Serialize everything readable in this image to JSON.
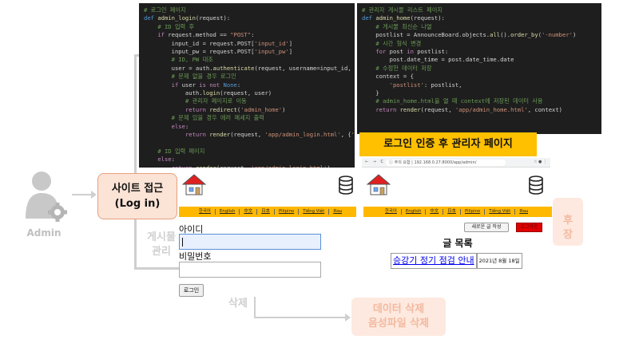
{
  "admin": {
    "label": "Admin"
  },
  "site_access": {
    "line1": "사이트 접근",
    "line2": "(Log in)"
  },
  "faded": {
    "board_manage": "게시물\n관리",
    "delete": "삭제",
    "data_delete": "데이터 삭제\n음성파일 삭제",
    "right_partial": "후\n장"
  },
  "code_left": [
    [
      [
        "cm",
        "# 로그인 페이지"
      ]
    ],
    [
      [
        "df",
        "def "
      ],
      [
        "fn",
        "admin_login"
      ],
      [
        "",
        "(request):"
      ]
    ],
    [
      [
        "",
        "    "
      ],
      [
        "cm",
        "# ID 입력 후"
      ]
    ],
    [
      [
        "",
        "    "
      ],
      [
        "kw",
        "if "
      ],
      [
        "",
        "request.method == "
      ],
      [
        "st",
        "\"POST\""
      ],
      [
        ":"
      ]
    ],
    [
      [
        "",
        "        input_id = request.POST["
      ],
      [
        "st",
        "'input_id'"
      ],
      [
        "",
        "]"
      ]
    ],
    [
      [
        "",
        "        input_pw = request.POST["
      ],
      [
        "st",
        "'input_pw'"
      ],
      [
        "",
        "]"
      ]
    ],
    [
      [
        "",
        "        "
      ],
      [
        "cm",
        "# ID, PW 대조"
      ]
    ],
    [
      [
        "",
        "        user = auth."
      ],
      [
        "fn",
        "authenticate"
      ],
      [
        "",
        "(request, username=input_id, passwo"
      ]
    ],
    [
      [
        "",
        "        "
      ],
      [
        "cm",
        "# 문제 없을 경우 로그인"
      ]
    ],
    [
      [
        "",
        "        "
      ],
      [
        "kw",
        "if "
      ],
      [
        "",
        "user "
      ],
      [
        "kw",
        "is not "
      ],
      [
        "df",
        "None"
      ],
      [
        ":"
      ]
    ],
    [
      [
        "",
        "            auth."
      ],
      [
        "fn",
        "login"
      ],
      [
        "",
        "(request, user)"
      ]
    ],
    [
      [
        "",
        "            "
      ],
      [
        "cm",
        "# 관리자 페이지로 이동"
      ]
    ],
    [
      [
        "",
        "            "
      ],
      [
        "kw",
        "return "
      ],
      [
        "fn",
        "redirect"
      ],
      [
        "",
        "("
      ],
      [
        "st",
        "'admin_home'"
      ],
      [
        ")"
      ]
    ],
    [
      [
        "",
        "        "
      ],
      [
        "cm",
        "# 문제 있을 경우 에러 메세지 출력"
      ]
    ],
    [
      [
        "",
        "        "
      ],
      [
        "kw",
        "else"
      ],
      [
        ":"
      ]
    ],
    [
      [
        "",
        "            "
      ],
      [
        "kw",
        "return "
      ],
      [
        "fn",
        "render"
      ],
      [
        "",
        "(request, "
      ],
      [
        "st",
        "'app/admin_login.html'"
      ],
      [
        "",
        ", {"
      ],
      [
        "st",
        "'error'"
      ]
    ],
    [
      [
        "",
        ""
      ]
    ],
    [
      [
        "",
        "    "
      ],
      [
        "cm",
        "# ID 입력 페이지"
      ]
    ],
    [
      [
        "",
        "    "
      ],
      [
        "kw",
        "else"
      ],
      [
        ":"
      ]
    ],
    [
      [
        "",
        "        "
      ],
      [
        "kw",
        "return "
      ],
      [
        "fn",
        "render"
      ],
      [
        "",
        "(request, "
      ],
      [
        "st",
        "'app/admin_login.html'"
      ],
      [
        ")"
      ]
    ]
  ],
  "code_right": [
    [
      [
        "cm",
        "# 관리자 게시물 리스트 페이지"
      ]
    ],
    [
      [
        "df",
        "def "
      ],
      [
        "fn",
        "admin_home"
      ],
      [
        "",
        "(request):"
      ]
    ],
    [
      [
        "",
        "    "
      ],
      [
        "cm",
        "# 게시물 최신순 나열"
      ]
    ],
    [
      [
        "",
        "    postlist = AnnounceBoard.objects."
      ],
      [
        "fn",
        "all"
      ],
      [
        "",
        "()."
      ],
      [
        "fn",
        "order_by"
      ],
      [
        "",
        "("
      ],
      [
        "st",
        "'-number'"
      ],
      [
        ")"
      ]
    ],
    [
      [
        "",
        "    "
      ],
      [
        "cm",
        "# 시간 형식 변경"
      ]
    ],
    [
      [
        "",
        "    "
      ],
      [
        "kw",
        "for "
      ],
      [
        "",
        "post "
      ],
      [
        "kw",
        "in "
      ],
      [
        "",
        "postlist:"
      ]
    ],
    [
      [
        "",
        "        post.date_time = post.date_time.date"
      ]
    ],
    [
      [
        "",
        "    "
      ],
      [
        "cm",
        "# 수정한 데이터 저장"
      ]
    ],
    [
      [
        "",
        "    context = {"
      ]
    ],
    [
      [
        "",
        "        "
      ],
      [
        "st",
        "'postlist'"
      ],
      [
        "",
        ": postlist,"
      ]
    ],
    [
      [
        "",
        "    }"
      ]
    ],
    [
      [
        "",
        "    "
      ],
      [
        "cm",
        "# admin_home.html을 열 때 context에 저장된 데이터 사용"
      ]
    ],
    [
      [
        "",
        "    "
      ],
      [
        "kw",
        "return "
      ],
      [
        "fn",
        "render"
      ],
      [
        "",
        "(request, "
      ],
      [
        "st",
        "'app/admin_home.html'"
      ],
      [
        "",
        ", context)"
      ]
    ]
  ],
  "caption": "로그인 인증 후 관리자 페이지",
  "browser": {
    "nav": "← → C ⌂",
    "url": "ⓘ 주의 요함 | 192.168.0.27:8000/app/admin/",
    "dots": "☆ ● ⋮"
  },
  "nav_items": [
    "한국어",
    "English",
    "中文",
    "日本",
    "Pilipino",
    "Tiếng Việt",
    "Язы"
  ],
  "login": {
    "id_label": "아이디",
    "pw_label": "비밀번호",
    "button": "로그인"
  },
  "admin_page": {
    "new_post": "새로운 글 작성",
    "logout": "로그아웃",
    "list_title": "글 목록",
    "posts": [
      {
        "title": "승강기 정기 점검 안내",
        "date": "2021년 8월 18일"
      }
    ]
  },
  "colors": {
    "caption_bg": "#ffc000",
    "navbar_bg": "#ffb800",
    "site_box_bg": "#fbe3d6",
    "code_bg": "#1e1e1e"
  }
}
